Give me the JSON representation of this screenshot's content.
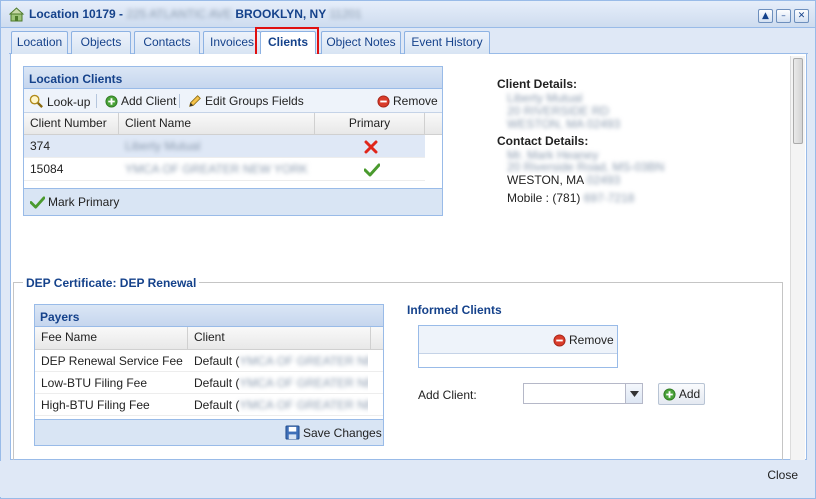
{
  "window": {
    "title_prefix": "Location 10179 -",
    "title_address_blurred": "225 ATLANTIC AVE",
    "title_city": "BROOKLYN, NY",
    "title_zip_blurred": "11201"
  },
  "tabs": [
    {
      "label": "Location"
    },
    {
      "label": "Objects"
    },
    {
      "label": "Contacts"
    },
    {
      "label": "Invoices"
    },
    {
      "label": "Clients"
    },
    {
      "label": "Object Notes"
    },
    {
      "label": "Event History"
    }
  ],
  "location_clients": {
    "title": "Location Clients",
    "toolbar": {
      "lookup": "Look-up",
      "add_client": "Add Client",
      "edit_groups": "Edit Groups Fields",
      "remove": "Remove"
    },
    "columns": [
      "Client Number",
      "Client Name",
      "Primary"
    ],
    "rows": [
      {
        "number": "374",
        "name_blurred": "Liberty Mutual",
        "primary": "x-icon"
      },
      {
        "number": "15084",
        "name_blurred": "YMCA OF GREATER NEW YORK",
        "primary": "check-icon"
      }
    ],
    "mark_primary": "Mark Primary"
  },
  "client_details": {
    "label": "Client Details:",
    "line1_blurred": "Liberty Mutual",
    "line2_blurred": "20 RIVERSIDE RD",
    "line3_blurred": "WESTON, MA 02493"
  },
  "contact_details": {
    "label": "Contact Details:",
    "line1_blurred": "Mr. Mark Heaney",
    "line2_blurred": "20 Riverside Road, MS-03BN",
    "city": "WESTON, MA",
    "zip_blurred": "02493",
    "mobile_label": "Mobile : (781)",
    "mobile_blurred": "697-7218"
  },
  "dep_certificate": {
    "legend": "DEP Certificate: DEP Renewal",
    "payers": {
      "title": "Payers",
      "columns": [
        "Fee Name",
        "Client"
      ],
      "rows": [
        {
          "fee": "DEP Renewal Service Fee",
          "client": "Default (",
          "client_blurred": "YMCA OF GREATER NE..."
        },
        {
          "fee": "Low-BTU Filing Fee",
          "client": "Default (",
          "client_blurred": "YMCA OF GREATER NE..."
        },
        {
          "fee": "High-BTU Filing Fee",
          "client": "Default (",
          "client_blurred": "YMCA OF GREATER NE..."
        }
      ],
      "save": "Save Changes"
    },
    "informed_clients": {
      "title": "Informed Clients",
      "remove": "Remove",
      "add_client_label": "Add Client:",
      "add_client_value": "",
      "add_button": "Add"
    }
  },
  "footer": {
    "close": "Close"
  },
  "colors": {
    "accent": "#15428b",
    "border": "#99bbe8",
    "highlight": "#e01010",
    "remove": "#d93c2b",
    "add": "#4aa33a"
  }
}
